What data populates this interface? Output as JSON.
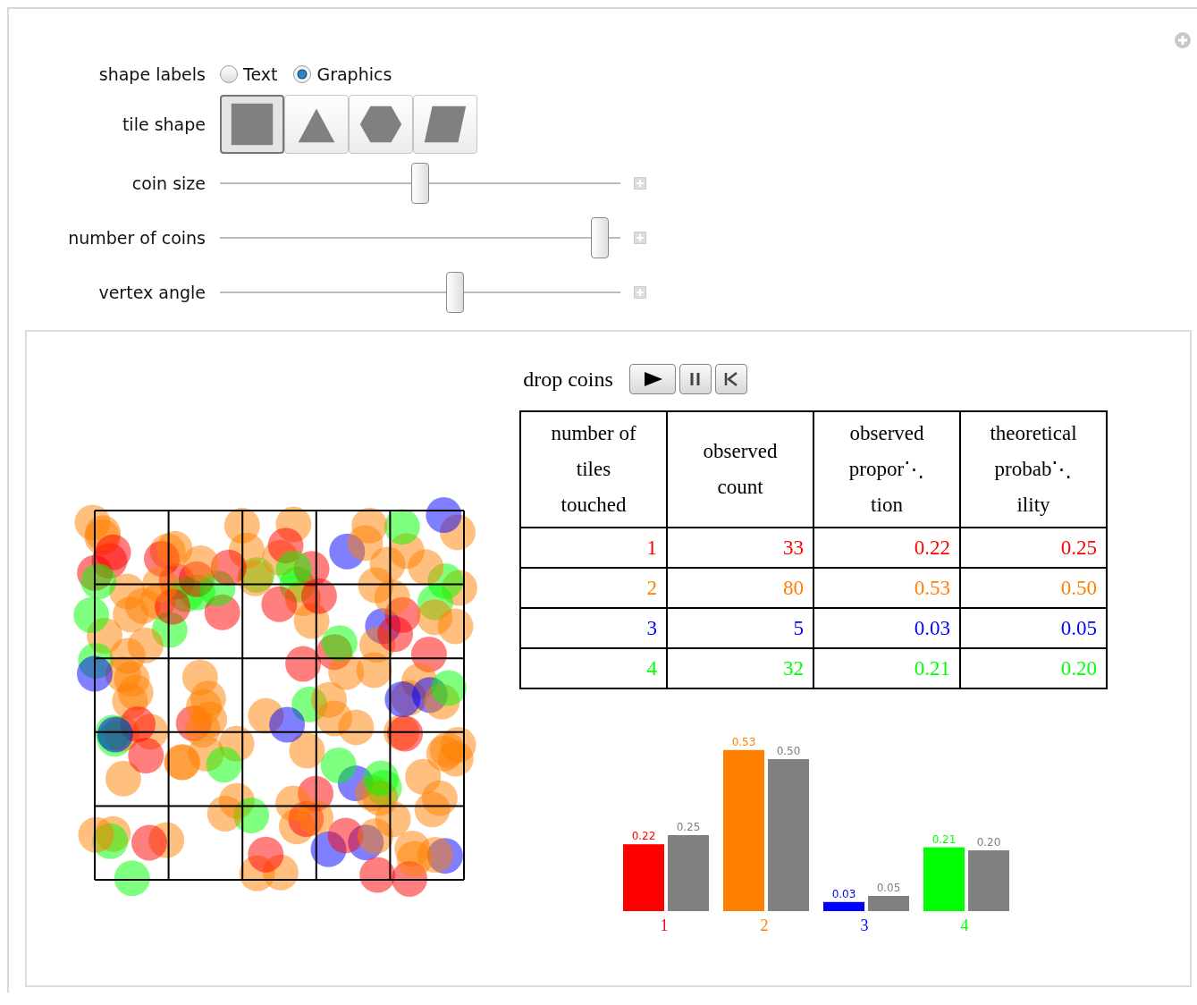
{
  "controls": {
    "shape_labels": {
      "label": "shape labels",
      "options": [
        {
          "label": "Text",
          "selected": false
        },
        {
          "label": "Graphics",
          "selected": true
        }
      ]
    },
    "tile_shape": {
      "label": "tile shape",
      "options": [
        {
          "kind": "square",
          "selected": true
        },
        {
          "kind": "triangle",
          "selected": false
        },
        {
          "kind": "hexagon",
          "selected": false
        },
        {
          "kind": "parallelogram",
          "selected": false
        }
      ]
    },
    "sliders": [
      {
        "label": "coin size",
        "level": 0.5
      },
      {
        "label": "number of coins",
        "level": 0.97
      },
      {
        "label": "vertex angle",
        "level": 0.59
      }
    ]
  },
  "animation": {
    "label": "drop coins",
    "buttons": [
      {
        "kind": "play"
      },
      {
        "kind": "pause"
      },
      {
        "kind": "reset"
      }
    ]
  },
  "table": {
    "columns": [
      "number of\ntiles\ntouched",
      "observed\ncount",
      "observed\npropor⋱\ntion",
      "theoretical\nprobab⋱\nility"
    ],
    "rows": [
      {
        "color": "#ff0000",
        "cells": [
          "1",
          "33",
          "0.22",
          "0.25"
        ]
      },
      {
        "color": "#ff8000",
        "cells": [
          "2",
          "80",
          "0.53",
          "0.50"
        ]
      },
      {
        "color": "#0000ff",
        "cells": [
          "3",
          "5",
          "0.03",
          "0.05"
        ]
      },
      {
        "color": "#00ff00",
        "cells": [
          "4",
          "32",
          "0.21",
          "0.20"
        ]
      }
    ]
  },
  "chart_data": {
    "type": "bar",
    "categories": [
      "1",
      "2",
      "3",
      "4"
    ],
    "data_labels": true,
    "series": [
      {
        "colors": [
          "#ff0000",
          "#ff8000",
          "#0000ff",
          "#00ff00"
        ],
        "values": [
          0.22,
          0.53,
          0.03,
          0.21
        ],
        "value_labels": [
          "0.22",
          "0.53",
          "0.03",
          "0.21"
        ]
      },
      {
        "color": "#808080",
        "values": [
          0.25,
          0.5,
          0.05,
          0.2
        ],
        "value_labels": [
          "0.25",
          "0.50",
          "0.05",
          "0.20"
        ]
      }
    ]
  }
}
